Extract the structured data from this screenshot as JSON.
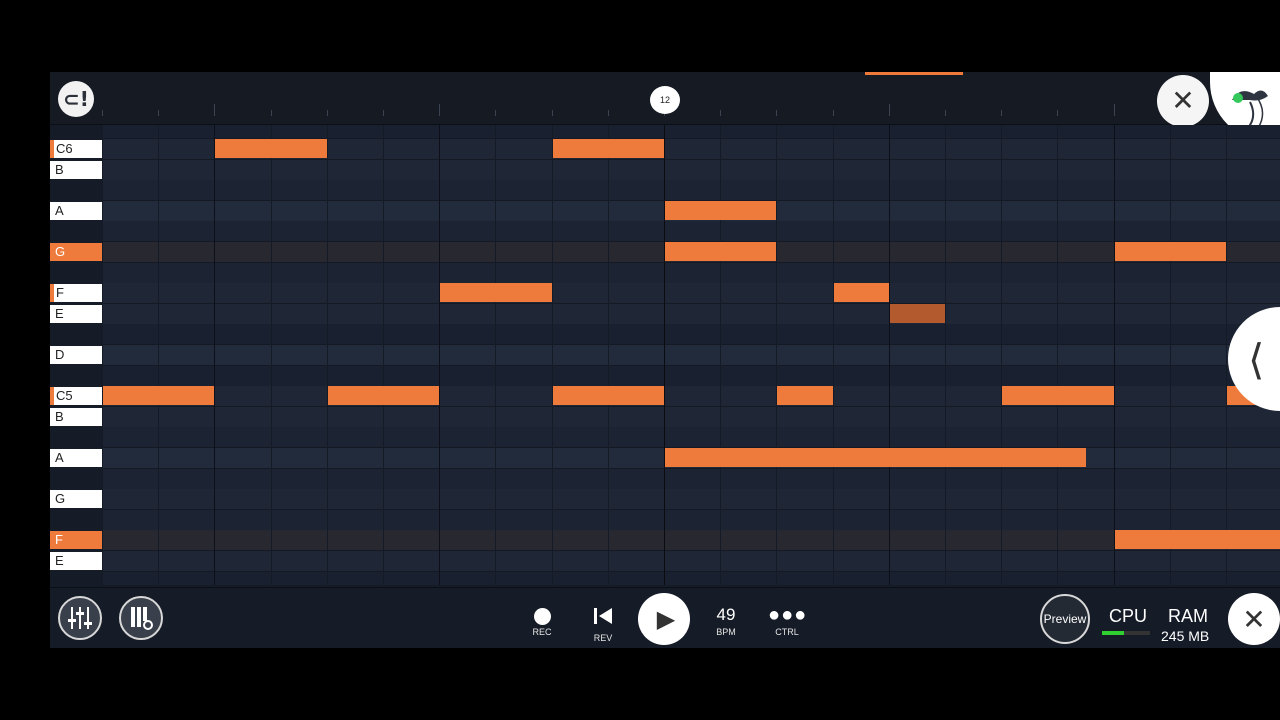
{
  "colors": {
    "accent": "#ee7b3c",
    "background": "#161c27",
    "meter": "#2fd02f"
  },
  "toolbar": {
    "magnet_icon": "magnet-icon",
    "playhead_label": "12",
    "close_icon": "close-icon",
    "logo_icon": "fl-fruit-logo-icon"
  },
  "keyboard": {
    "keys": [
      {
        "label": "C6",
        "state": "marked"
      },
      {
        "label": "B",
        "state": "white"
      },
      {
        "label": "A",
        "state": "white"
      },
      {
        "label": "G",
        "state": "highlighted"
      },
      {
        "label": "F",
        "state": "marked"
      },
      {
        "label": "E",
        "state": "white"
      },
      {
        "label": "D",
        "state": "white"
      },
      {
        "label": "C5",
        "state": "marked"
      },
      {
        "label": "B",
        "state": "white"
      },
      {
        "label": "A",
        "state": "white"
      },
      {
        "label": "G",
        "state": "white"
      },
      {
        "label": "F",
        "state": "highlighted"
      },
      {
        "label": "E",
        "state": "white"
      }
    ]
  },
  "piano_roll": {
    "notes": [
      {
        "pitch": "C6",
        "start": 2,
        "length": 2,
        "style": "normal"
      },
      {
        "pitch": "C6",
        "start": 8,
        "length": 2,
        "style": "normal"
      },
      {
        "pitch": "A5",
        "start": 10,
        "length": 2,
        "style": "normal"
      },
      {
        "pitch": "G5",
        "start": 10,
        "length": 2,
        "style": "normal"
      },
      {
        "pitch": "G5",
        "start": 18,
        "length": 2,
        "style": "normal"
      },
      {
        "pitch": "F5",
        "start": 6,
        "length": 2,
        "style": "normal"
      },
      {
        "pitch": "F5",
        "start": 13,
        "length": 1,
        "style": "normal"
      },
      {
        "pitch": "E5",
        "start": 14,
        "length": 1,
        "style": "dim"
      },
      {
        "pitch": "C5",
        "start": 0,
        "length": 2,
        "style": "normal"
      },
      {
        "pitch": "C5",
        "start": 4,
        "length": 2,
        "style": "normal"
      },
      {
        "pitch": "C5",
        "start": 8,
        "length": 2,
        "style": "normal"
      },
      {
        "pitch": "C5",
        "start": 12,
        "length": 1,
        "style": "normal"
      },
      {
        "pitch": "C5",
        "start": 16,
        "length": 2,
        "style": "normal"
      },
      {
        "pitch": "C5",
        "start": 20,
        "length": 1,
        "style": "normal"
      },
      {
        "pitch": "A4",
        "start": 10,
        "length": 7.5,
        "style": "normal"
      },
      {
        "pitch": "F4",
        "start": 18,
        "length": 3,
        "style": "normal"
      }
    ]
  },
  "side_panel": {
    "expand_icon": "chevron-left-icon"
  },
  "transport": {
    "mixer_icon": "mixer-sliders-icon",
    "piano_settings_icon": "piano-settings-icon",
    "rec_label": "REC",
    "rev_label": "REV",
    "play_icon": "play-icon",
    "bpm_value": "49",
    "bpm_label": "BPM",
    "ctrl_label": "CTRL",
    "preview_label": "Preview",
    "cpu_label": "CPU",
    "cpu_load": 0.45,
    "ram_label": "RAM",
    "ram_value": "245 MB",
    "close_icon": "close-icon"
  }
}
